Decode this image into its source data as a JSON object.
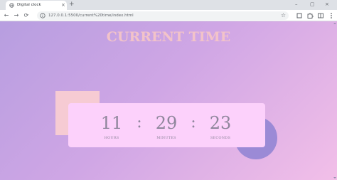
{
  "browser": {
    "tab_title": "Digital clock",
    "tab_close": "×",
    "new_tab": "+",
    "url": "127.0.0.1:5500/current%20time/index.html",
    "star": "☆",
    "back": "←",
    "forward": "→",
    "reload": "⟳",
    "minimize": "–",
    "maximize": "▢",
    "close": "×"
  },
  "page": {
    "heading": "CURRENT TIME",
    "hours": "11",
    "minutes": "29",
    "seconds": "23",
    "separator": ":",
    "hours_label": "HOURS",
    "minutes_label": "MINUTES",
    "seconds_label": "SECONDS"
  },
  "colors": {
    "heading": "#f2c3c9",
    "clock_panel": "#fcd1fb",
    "clock_text": "#8f869c",
    "square": "#f6cbd3",
    "circle": "#9b8ad6"
  }
}
